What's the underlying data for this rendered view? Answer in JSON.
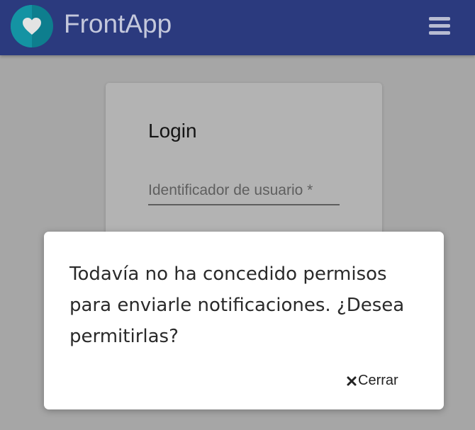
{
  "header": {
    "brand": "FrontApp",
    "logo_icon": "heart-icon",
    "menu_icon": "hamburger-menu-icon",
    "background_color": "#2b3a7e"
  },
  "login": {
    "title": "Login",
    "username_placeholder": "Identificador de usuario *",
    "username_value": ""
  },
  "modal": {
    "message": "Todavía no ha concedido permisos para enviarle notificaciones. ¿Desea permitirlas?",
    "close_label": "Cerrar",
    "close_icon": "close-x-icon"
  }
}
